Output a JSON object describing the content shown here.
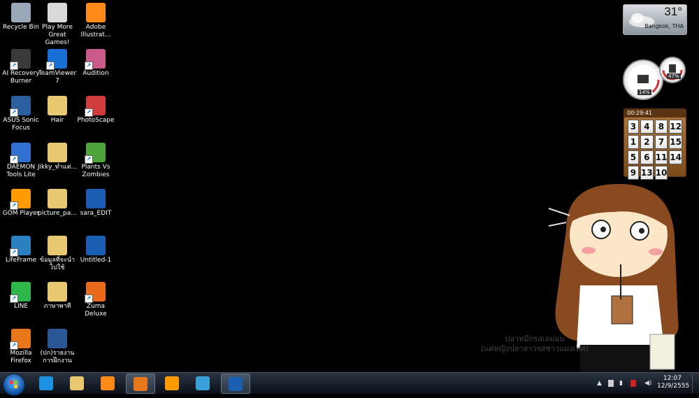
{
  "desktop_icons": [
    {
      "label": "Recycle Bin",
      "icon": "recycle-bin-icon",
      "color": "#9aa8b8",
      "shortcut": false
    },
    {
      "label": "Play More Great Games!",
      "icon": "games-icon",
      "color": "#d9d9d9",
      "shortcut": false
    },
    {
      "label": "Adobe Illustrat...",
      "icon": "illustrator-icon",
      "color": "#ff8a1a",
      "shortcut": false
    },
    {
      "label": "AI Recovery Burner",
      "icon": "recovery-icon",
      "color": "#3a3a3a",
      "shortcut": true
    },
    {
      "label": "TeamViewer 7",
      "icon": "teamviewer-icon",
      "color": "#1a6fd6",
      "shortcut": true
    },
    {
      "label": "Audition",
      "icon": "audition-icon",
      "color": "#c95a8a",
      "shortcut": true
    },
    {
      "label": "ASUS Sonic Focus",
      "icon": "asus-icon",
      "color": "#2a5fa0",
      "shortcut": true
    },
    {
      "label": "Hair",
      "icon": "folder-icon",
      "color": "#e8c870",
      "shortcut": false
    },
    {
      "label": "PhotoScape",
      "icon": "photoscape-icon",
      "color": "#d03c3c",
      "shortcut": true
    },
    {
      "label": "DAEMON Tools Lite",
      "icon": "daemon-tools-icon",
      "color": "#3070d0",
      "shortcut": true
    },
    {
      "label": "Jikky_ทำแต่...",
      "icon": "folder-icon",
      "color": "#e8c870",
      "shortcut": false
    },
    {
      "label": "Plants Vs Zombies",
      "icon": "pvz-icon",
      "color": "#4ca43a",
      "shortcut": true
    },
    {
      "label": "GOM Player",
      "icon": "gom-player-icon",
      "color": "#ff9a00",
      "shortcut": true
    },
    {
      "label": "picture_pa...",
      "icon": "folder-icon",
      "color": "#e8c870",
      "shortcut": false
    },
    {
      "label": "sara_EDIT",
      "icon": "psd-file-icon",
      "color": "#1a5fb4",
      "shortcut": false
    },
    {
      "label": "LifeFrame",
      "icon": "lifeframe-icon",
      "color": "#2a80c0",
      "shortcut": true
    },
    {
      "label": "ข้อมูลที่จะนำไปใช้",
      "icon": "folder-icon",
      "color": "#e8c870",
      "shortcut": false
    },
    {
      "label": "Untitled-1",
      "icon": "psd-file-icon",
      "color": "#1a5fb4",
      "shortcut": false
    },
    {
      "label": "LINE",
      "icon": "line-icon",
      "color": "#2fb84a",
      "shortcut": true
    },
    {
      "label": "ภาษาพาที",
      "icon": "folder-icon",
      "color": "#e8c870",
      "shortcut": false
    },
    {
      "label": "Zuma Deluxe",
      "icon": "zuma-icon",
      "color": "#e86a1a",
      "shortcut": true
    },
    {
      "label": "Mozilla Firefox",
      "icon": "firefox-icon",
      "color": "#e8761a",
      "shortcut": true
    },
    {
      "label": "(ปก)รายงานการฝึกงาน",
      "icon": "word-doc-icon",
      "color": "#2b5797",
      "shortcut": false
    }
  ],
  "weather": {
    "temp": "31°",
    "city": "Bangkok, THA"
  },
  "meter": {
    "cpu": "14%",
    "mem": "47%",
    "cpu_level": 0.14,
    "mem_level": 0.47
  },
  "puzzle": {
    "time": "00:29:41",
    "tiles": [
      "3",
      "4",
      "8",
      "12",
      "1",
      "2",
      "7",
      "15",
      "5",
      "6",
      "11",
      "14",
      "9",
      "13",
      "10",
      ""
    ]
  },
  "wallpaper": {
    "caption_line1": "ปลาหมึกรสเลม่อน",
    "caption_line2": "(แค่หญิงปลาสาวรสชาวแม่งเทศ)"
  },
  "taskbar": {
    "buttons": [
      {
        "name": "internet-explorer",
        "color": "#1e90e0",
        "active": false
      },
      {
        "name": "windows-explorer",
        "color": "#e8c870",
        "active": false
      },
      {
        "name": "media-player",
        "color": "#ff8a1a",
        "active": false
      },
      {
        "name": "firefox",
        "color": "#e8761a",
        "active": true
      },
      {
        "name": "gom-player",
        "color": "#ff9a00",
        "active": false
      },
      {
        "name": "messenger",
        "color": "#3aa0d8",
        "active": false
      },
      {
        "name": "photoshop",
        "color": "#1a5fb4",
        "active": true
      }
    ],
    "clock_time": "12:07",
    "clock_date": "12/9/2555"
  }
}
